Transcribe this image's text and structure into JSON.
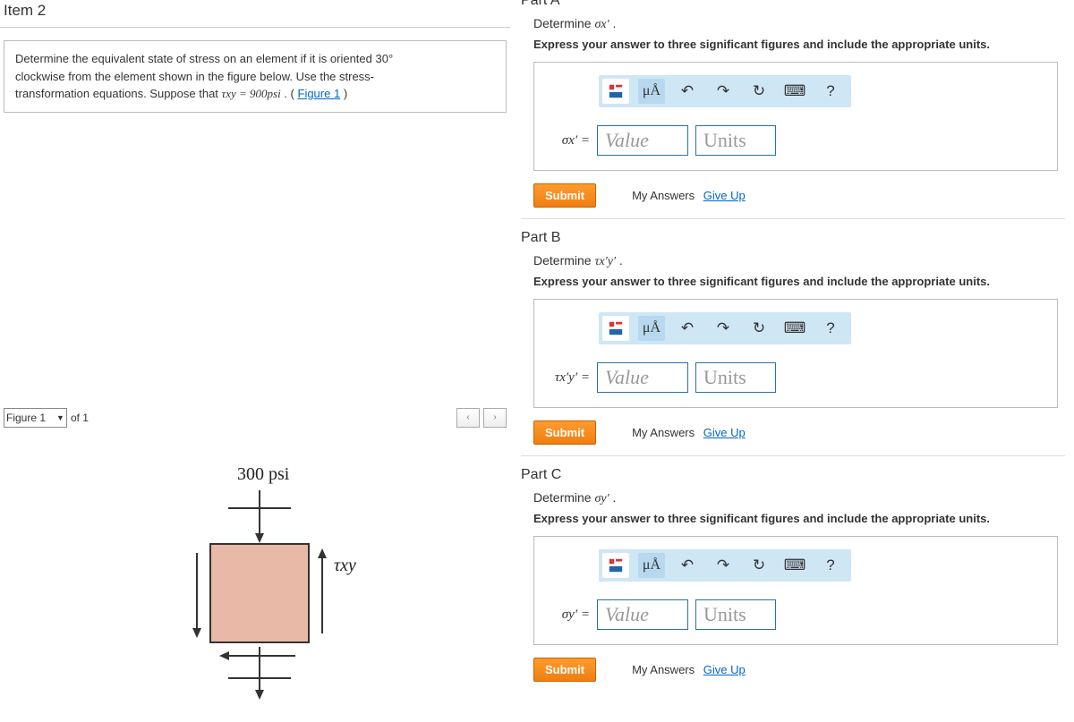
{
  "left": {
    "item_title": "Item 2",
    "problem_text_1": "Determine the equivalent state of stress on an element if it is oriented 30°",
    "problem_text_2": "clockwise from the element shown in the figure below. Use the stress-",
    "problem_text_3": "transformation equations. Suppose that ",
    "tau_expr": "τxy = 900psi",
    "period_open": " . (",
    "figure_link": "Figure 1",
    "close_paren": ")",
    "figure_select": "Figure 1",
    "of_text": "of 1",
    "stress_label": "300 psi",
    "tau_label": "τxy"
  },
  "parts": {
    "a": {
      "heading": "Part A",
      "det1": "Determine ",
      "det2": "σx′",
      "det3": " .",
      "eq": "σx′ ="
    },
    "b": {
      "heading": "Part B",
      "det1": "Determine ",
      "det2": "τx′y′",
      "det3": " .",
      "eq": "τx′y′ ="
    },
    "c": {
      "heading": "Part C",
      "det1": "Determine ",
      "det2": "σy′",
      "det3": " .",
      "eq": "σy′ ="
    }
  },
  "common": {
    "instr": "Express your answer to three significant figures and include the appropriate units.",
    "value_ph": "Value",
    "units_ph": "Units",
    "submit": "Submit",
    "my_answers": "My Answers",
    "give_up": "Give Up",
    "ua": "μÅ",
    "qmark": "?"
  }
}
